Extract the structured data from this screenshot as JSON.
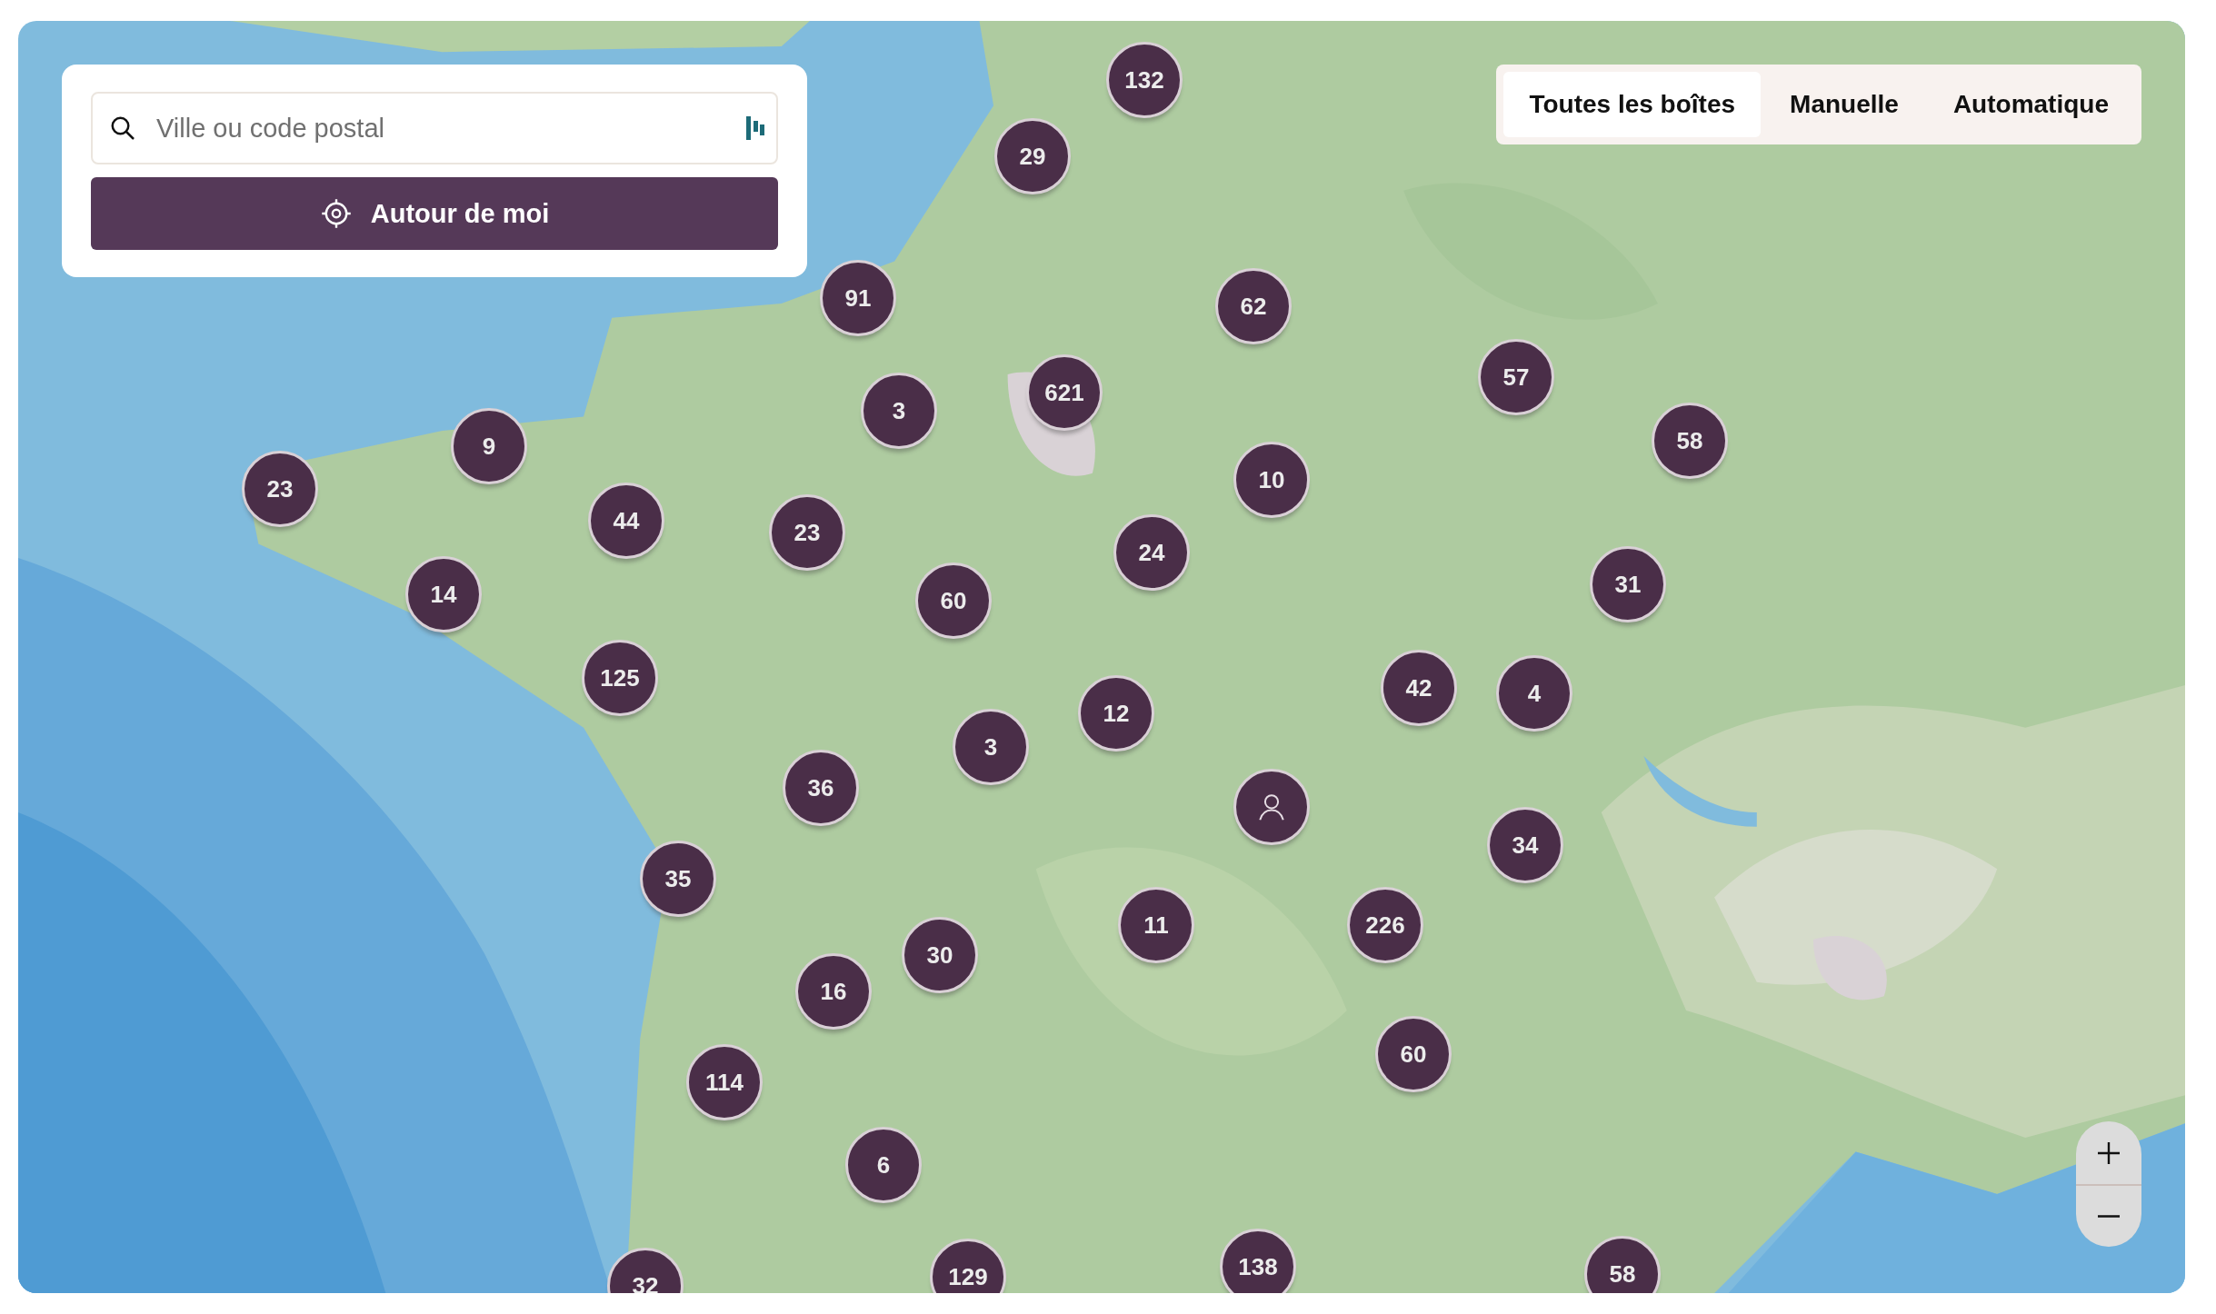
{
  "search": {
    "placeholder": "Ville ou code postal"
  },
  "locate_button": {
    "label": "Autour de moi"
  },
  "tabs": [
    {
      "label": "Toutes les boîtes",
      "selected": true
    },
    {
      "label": "Manuelle",
      "selected": false
    },
    {
      "label": "Automatique",
      "selected": false
    }
  ],
  "markers": [
    {
      "kind": "cluster",
      "label": "132"
    },
    {
      "kind": "cluster",
      "label": "29"
    },
    {
      "kind": "cluster",
      "label": "91"
    },
    {
      "kind": "cluster",
      "label": "62"
    },
    {
      "kind": "cluster",
      "label": "621"
    },
    {
      "kind": "cluster",
      "label": "3"
    },
    {
      "kind": "cluster",
      "label": "57"
    },
    {
      "kind": "cluster",
      "label": "58"
    },
    {
      "kind": "cluster",
      "label": "9"
    },
    {
      "kind": "cluster",
      "label": "23"
    },
    {
      "kind": "cluster",
      "label": "10"
    },
    {
      "kind": "cluster",
      "label": "44"
    },
    {
      "kind": "cluster",
      "label": "23"
    },
    {
      "kind": "cluster",
      "label": "24"
    },
    {
      "kind": "cluster",
      "label": "14"
    },
    {
      "kind": "cluster",
      "label": "60"
    },
    {
      "kind": "cluster",
      "label": "31"
    },
    {
      "kind": "cluster",
      "label": "125"
    },
    {
      "kind": "cluster",
      "label": "42"
    },
    {
      "kind": "cluster",
      "label": "4"
    },
    {
      "kind": "cluster",
      "label": "12"
    },
    {
      "kind": "cluster",
      "label": "3"
    },
    {
      "kind": "cluster",
      "label": "36"
    },
    {
      "kind": "user"
    },
    {
      "kind": "cluster",
      "label": "34"
    },
    {
      "kind": "cluster",
      "label": "35"
    },
    {
      "kind": "cluster",
      "label": "11"
    },
    {
      "kind": "cluster",
      "label": "226"
    },
    {
      "kind": "cluster",
      "label": "30"
    },
    {
      "kind": "cluster",
      "label": "16"
    },
    {
      "kind": "cluster",
      "label": "60"
    },
    {
      "kind": "cluster",
      "label": "114"
    },
    {
      "kind": "cluster",
      "label": "6"
    },
    {
      "kind": "cluster",
      "label": "32"
    },
    {
      "kind": "cluster",
      "label": "129"
    },
    {
      "kind": "cluster",
      "label": "138"
    },
    {
      "kind": "cluster",
      "label": "58"
    }
  ]
}
